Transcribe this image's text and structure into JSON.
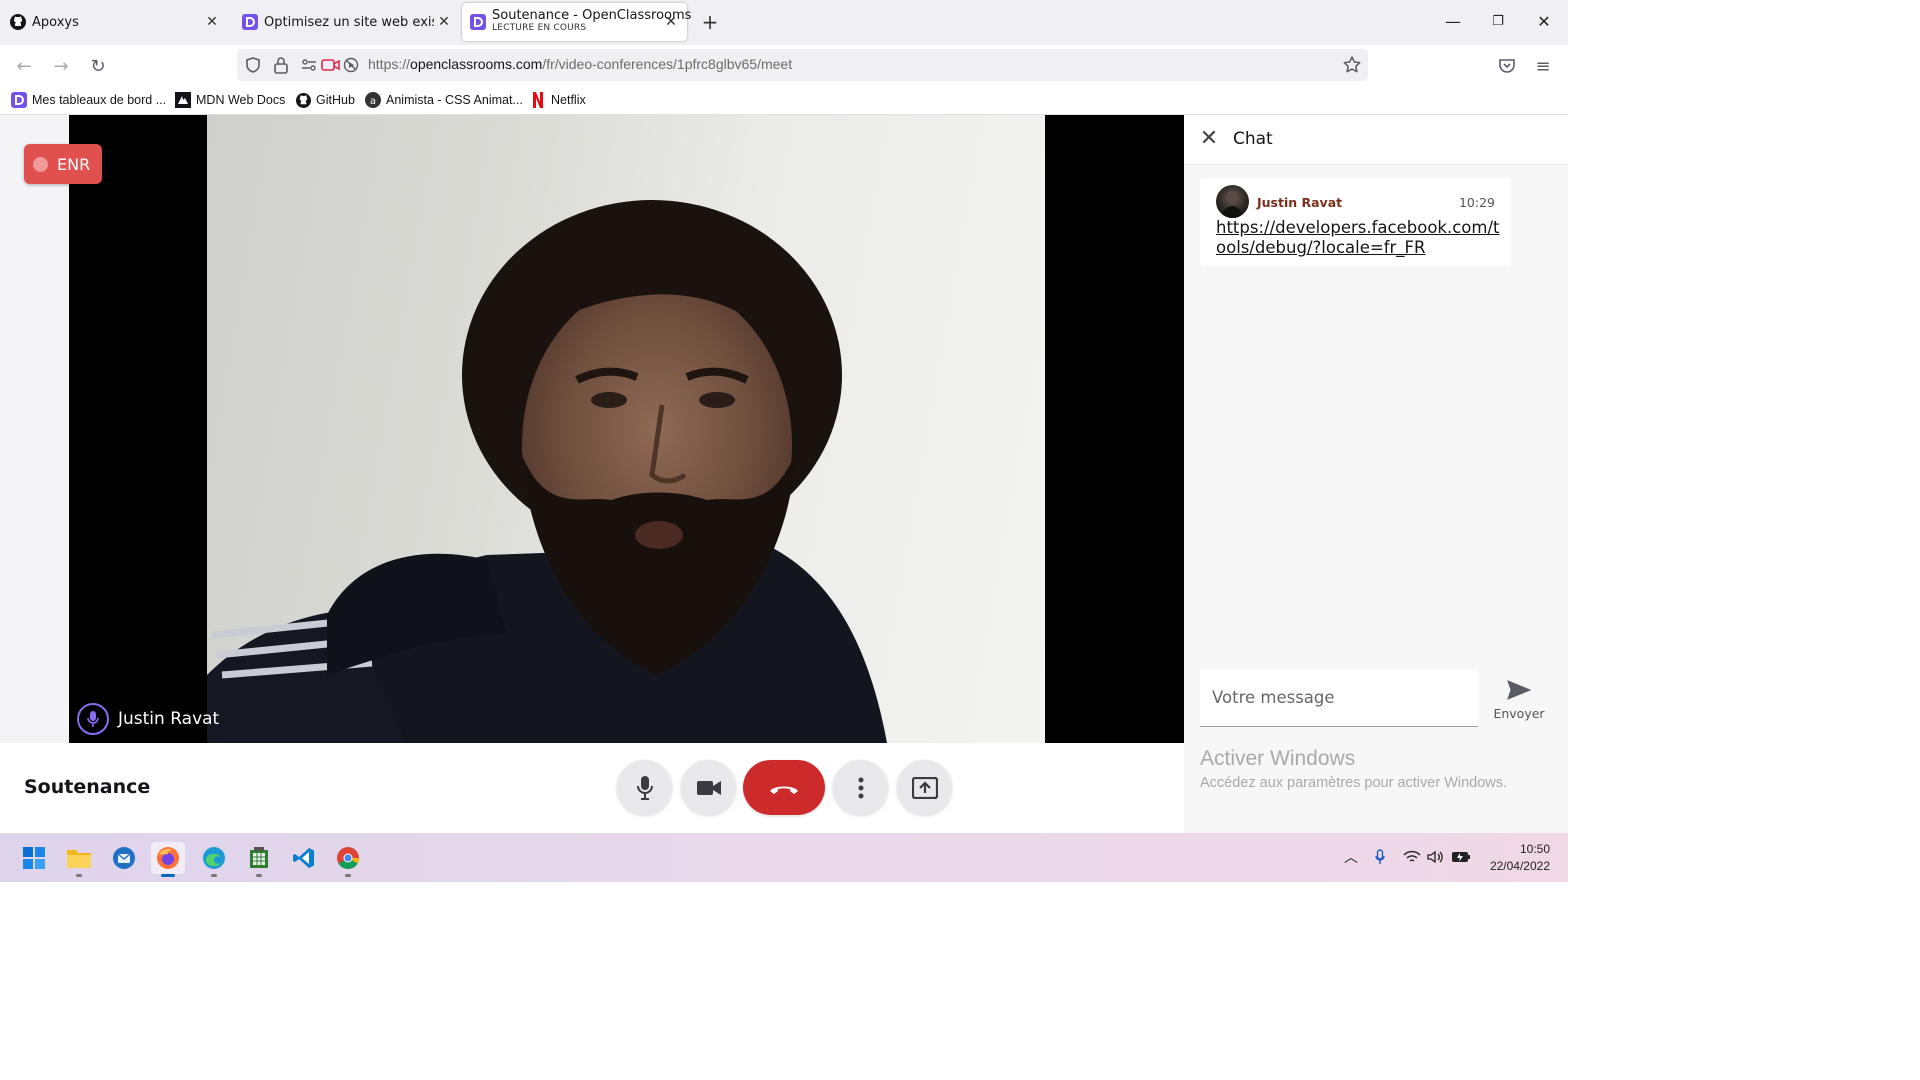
{
  "browser": {
    "tabs": [
      {
        "title": "Apoxys",
        "icon": "github-icon"
      },
      {
        "title": "Optimisez un site web existant -",
        "icon": "openclassrooms-icon"
      },
      {
        "title": "Soutenance - OpenClassrooms",
        "subtitle": "LECTURE EN COURS",
        "icon": "openclassrooms-icon",
        "active": true
      }
    ],
    "url": {
      "scheme": "https://",
      "host": "openclassrooms.com",
      "path": "/fr/video-conferences/1pfrc8glbv65/meet"
    },
    "bookmarks": [
      {
        "label": "Mes tableaux de bord ...",
        "icon": "openclassrooms-icon"
      },
      {
        "label": "MDN Web Docs",
        "icon": "mdn-icon"
      },
      {
        "label": "GitHub",
        "icon": "github-icon"
      },
      {
        "label": "Animista - CSS Animat...",
        "icon": "animista-icon"
      },
      {
        "label": "Netflix",
        "icon": "netflix-icon"
      }
    ]
  },
  "meeting": {
    "recording_label": "ENR",
    "participant_name": "Justin Ravat",
    "title": "Soutenance"
  },
  "chat": {
    "title": "Chat",
    "messages": [
      {
        "author": "Justin Ravat",
        "time": "10:29",
        "text": "https://developers.facebook.com/tools/debug/?locale=fr_FR"
      }
    ],
    "input_placeholder": "Votre message",
    "send_label": "Envoyer"
  },
  "watermark": {
    "line1": "Activer Windows",
    "line2": "Accédez aux paramètres pour activer Windows."
  },
  "taskbar": {
    "time": "10:50",
    "date": "22/04/2022"
  },
  "colors": {
    "accent": "#7451eb",
    "hangup": "#cd2b2b",
    "recording": "#e0504f",
    "author": "#7b2e1a"
  }
}
